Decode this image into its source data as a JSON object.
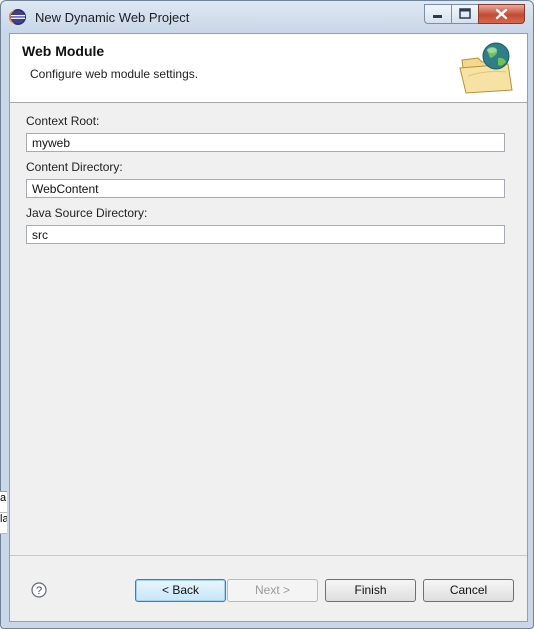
{
  "window": {
    "title": "New Dynamic Web Project",
    "icon": "eclipse-icon"
  },
  "header": {
    "title": "Web Module",
    "description": "Configure web module settings.",
    "icon": "folder-globe-icon"
  },
  "fields": [
    {
      "label": "Context Root:",
      "value": "myweb"
    },
    {
      "label": "Content Directory:",
      "value": "WebContent"
    },
    {
      "label": "Java Source Directory:",
      "value": "src"
    }
  ],
  "buttons": {
    "back": "< Back",
    "next": "Next >",
    "finish": "Finish",
    "cancel": "Cancel"
  },
  "background_fragments": {
    "line1": "a",
    "line2": "la"
  }
}
